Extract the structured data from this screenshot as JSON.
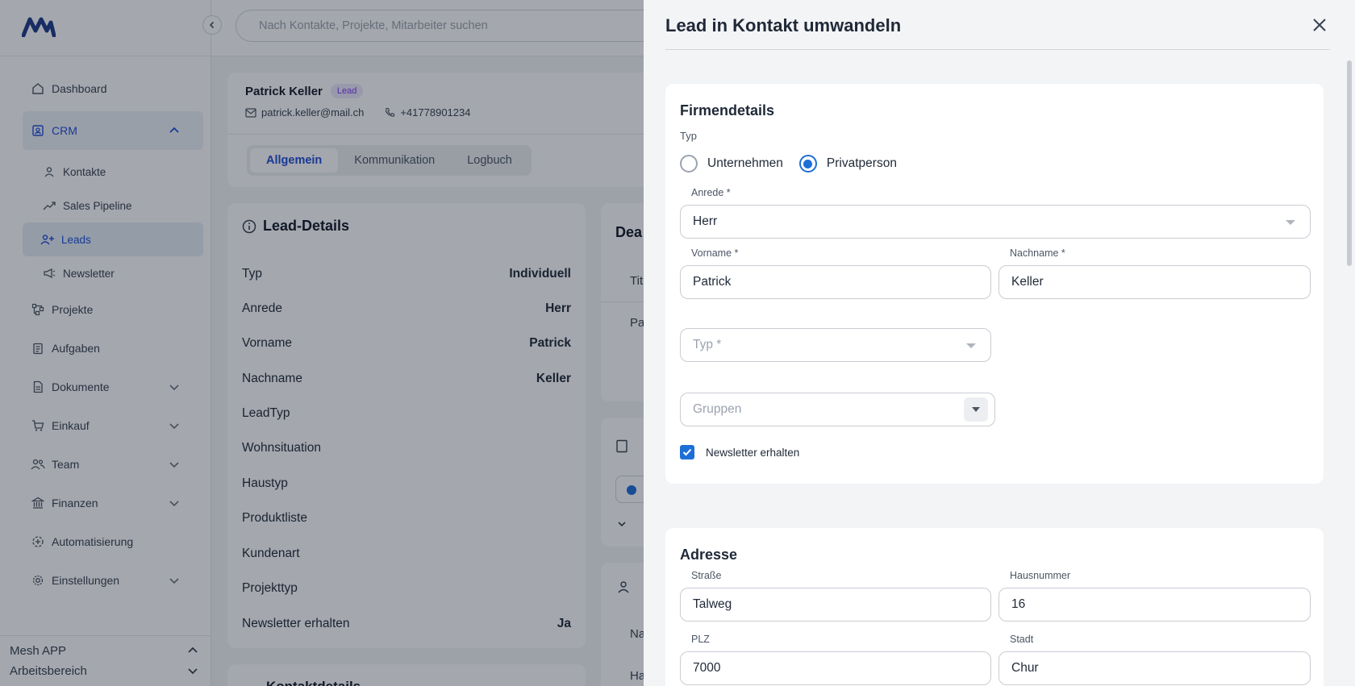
{
  "search": {
    "placeholder": "Nach Kontakte, Projekte, Mitarbeiter suchen"
  },
  "sidebar": {
    "items": {
      "dashboard": "Dashboard",
      "crm": "CRM",
      "kontakte": "Kontakte",
      "sales_pipeline": "Sales Pipeline",
      "leads": "Leads",
      "newsletter": "Newsletter",
      "projekte": "Projekte",
      "aufgaben": "Aufgaben",
      "dokumente": "Dokumente",
      "einkauf": "Einkauf",
      "team": "Team",
      "finanzen": "Finanzen",
      "automatisierung": "Automatisierung",
      "einstellungen": "Einstellungen"
    },
    "footer": {
      "app": "Mesh APP",
      "workspace": "Arbeitsbereich"
    }
  },
  "lead": {
    "name": "Patrick Keller",
    "badge": "Lead",
    "email": "patrick.keller@mail.ch",
    "phone": "+41778901234",
    "tabs": [
      "Allgemein",
      "Kommunikation",
      "Logbuch"
    ]
  },
  "details": {
    "title": "Lead-Details",
    "rows": [
      {
        "label": "Typ",
        "value": "Individuell"
      },
      {
        "label": "Anrede",
        "value": "Herr"
      },
      {
        "label": "Vorname",
        "value": "Patrick"
      },
      {
        "label": "Nachname",
        "value": "Keller"
      },
      {
        "label": "LeadTyp",
        "value": ""
      },
      {
        "label": "Wohnsituation",
        "value": ""
      },
      {
        "label": "Haustyp",
        "value": ""
      },
      {
        "label": "Produktliste",
        "value": ""
      },
      {
        "label": "Kundenart",
        "value": ""
      },
      {
        "label": "Projekttyp",
        "value": ""
      },
      {
        "label": "Newsletter erhalten",
        "value": "Ja"
      }
    ],
    "partial": {
      "deal_title": "Dea",
      "col1": "Tit",
      "col2": "Pa",
      "col3": "Na",
      "col4": "Ha",
      "bottom_title": "Kontaktdetails"
    }
  },
  "drawer": {
    "title": "Lead in Kontakt umwandeln",
    "firm": {
      "title": "Firmendetails",
      "typ_label": "Typ",
      "radio_options": [
        "Unternehmen",
        "Privatperson"
      ],
      "selected": "Privatperson",
      "anrede_label": "Anrede *",
      "anrede_value": "Herr",
      "vorname_label": "Vorname *",
      "vorname_value": "Patrick",
      "nachname_label": "Nachname *",
      "nachname_value": "Keller",
      "typ_placeholder": "Typ *",
      "gruppen_placeholder": "Gruppen",
      "newsletter_label": "Newsletter erhalten",
      "newsletter_checked": true
    },
    "address": {
      "title": "Adresse",
      "strasse_label": "Straße",
      "strasse_value": "Talweg",
      "hausnummer_label": "Hausnummer",
      "hausnummer_value": "16",
      "plz_label": "PLZ",
      "plz_value": "7000",
      "stadt_label": "Stadt",
      "stadt_value": "Chur"
    }
  },
  "colors": {
    "accent": "#1d6fd8",
    "brand": "#1d4ed8",
    "badge": "#7c3aed"
  }
}
